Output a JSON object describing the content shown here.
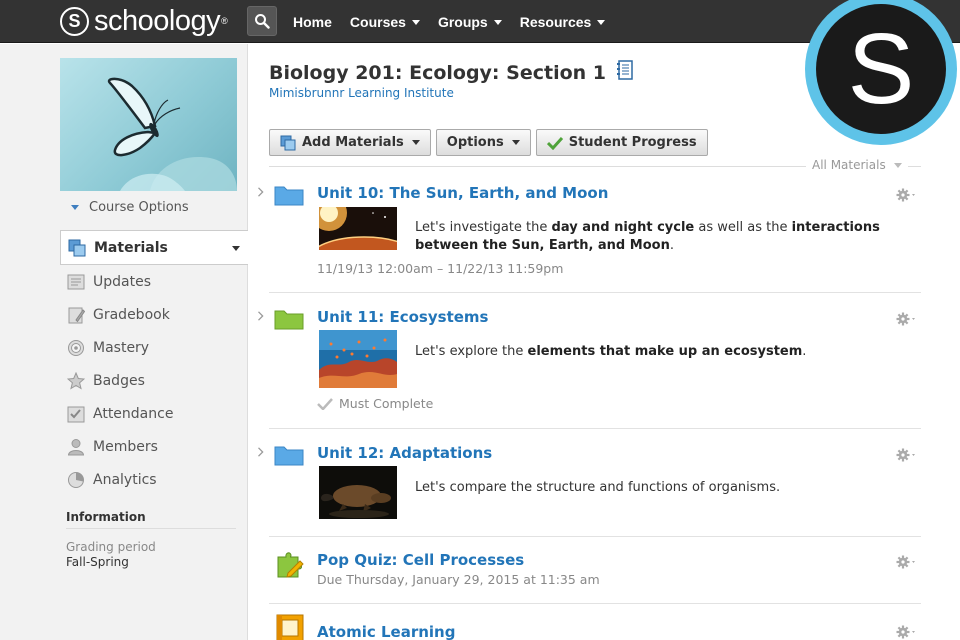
{
  "topbar": {
    "logo_text": "schoology",
    "logo_tm": "®",
    "nav": [
      {
        "label": "Home",
        "dropdown": false
      },
      {
        "label": "Courses",
        "dropdown": true
      },
      {
        "label": "Groups",
        "dropdown": true
      },
      {
        "label": "Resources",
        "dropdown": true
      }
    ]
  },
  "badge": {
    "letter": "S",
    "ring_color": "#5ec3e8"
  },
  "sidebar": {
    "course_options": "Course Options",
    "menu": [
      {
        "label": "Materials",
        "icon": "materials-icon",
        "active": true
      },
      {
        "label": "Updates",
        "icon": "updates-icon"
      },
      {
        "label": "Gradebook",
        "icon": "gradebook-icon"
      },
      {
        "label": "Mastery",
        "icon": "mastery-icon"
      },
      {
        "label": "Badges",
        "icon": "badges-icon"
      },
      {
        "label": "Attendance",
        "icon": "attendance-icon"
      },
      {
        "label": "Members",
        "icon": "members-icon"
      },
      {
        "label": "Analytics",
        "icon": "analytics-icon"
      }
    ],
    "info_title": "Information",
    "grading_period_label": "Grading period",
    "grading_period_value": "Fall-Spring"
  },
  "main": {
    "course_title": "Biology 201: Ecology: Section 1",
    "school": "Mimisbrunnr Learning Institute",
    "toolbar": {
      "add_materials": "Add Materials",
      "options": "Options",
      "student_progress": "Student Progress"
    },
    "filter": "All Materials",
    "items": [
      {
        "title": "Unit 10: The Sun, Earth, and Moon",
        "type": "folder",
        "folder_color": "#5aa9e6",
        "desc_1": "Let's investigate the ",
        "desc_b1": "day and night cycle",
        "desc_2": " as well as the ",
        "desc_b2": "interactions between the Sun, Earth, and Moon",
        "desc_3": ".",
        "meta": "11/19/13 12:00am – 11/22/13 11:59pm"
      },
      {
        "title": "Unit 11: Ecosystems",
        "type": "folder",
        "folder_color": "#8cc63f",
        "desc_1": "Let's explore the ",
        "desc_b1": "elements that make up an ecosystem",
        "desc_2": ".",
        "meta": "Must Complete"
      },
      {
        "title": "Unit 12: Adaptations",
        "type": "folder",
        "folder_color": "#5aa9e6",
        "desc_1": "Let's compare the structure and functions of organisms."
      },
      {
        "title": "Pop Quiz: Cell Processes",
        "type": "quiz",
        "meta": "Due Thursday, January 29, 2015 at 11:35 am"
      },
      {
        "title": "Atomic Learning",
        "type": "external"
      }
    ]
  }
}
